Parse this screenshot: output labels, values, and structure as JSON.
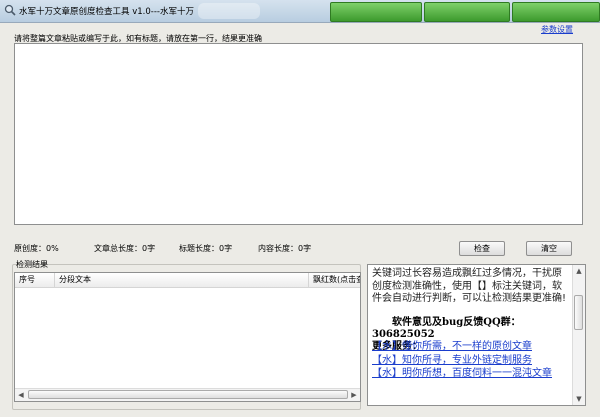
{
  "window": {
    "title": "水军十万文章原创度检查工具 v1.0---水军十万",
    "icon": "magnifier-icon"
  },
  "toolbar": {
    "params_link": "参数设置"
  },
  "editor": {
    "hint": "请将整篇文章粘贴或编写于此，如有标题，请放在第一行，结果更准确",
    "value": ""
  },
  "stats": {
    "originality": "原创度：0%",
    "total_length": "文章总长度：0字",
    "title_length": "标题长度：0字",
    "content_length": "内容长度：0字"
  },
  "actions": {
    "check": "检查",
    "clear": "清空"
  },
  "results": {
    "group_label": "检测结果",
    "columns": [
      "序号",
      "分段文本",
      "飘红数(点击查"
    ]
  },
  "info": {
    "text": "关键词过长容易造成飘红过多情况，干扰原创度检测准确性，使用【】标注关键词，软件会自动进行判断，可以让检测结果更准确!",
    "feedback_label": "软件意见及bug反馈QQ群：",
    "feedback_qq": "306825052",
    "more_services": "更多服务：",
    "links": [
      "【水】懂你所需，不一样的原创文章",
      "【水】知你所寻，专业外链定制服务",
      "【水】明你所想，百度伺料一一混沌文章"
    ]
  },
  "colors": {
    "link": "#1a3dcc",
    "window_bg": "#ecebe6",
    "green_button": "#4caf3a"
  }
}
